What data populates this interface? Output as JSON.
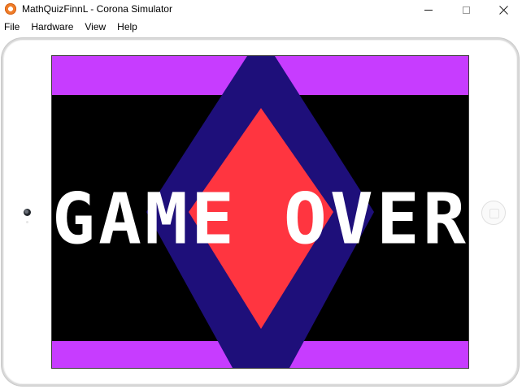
{
  "window": {
    "title": "MathQuizFinnL - Corona Simulator",
    "icon": "corona-app-icon",
    "controls": {
      "minimize_icon": "minimize-icon",
      "maximize_icon": "maximize-icon",
      "close_icon": "close-icon"
    }
  },
  "menubar": {
    "items": [
      {
        "label": "File"
      },
      {
        "label": "Hardware"
      },
      {
        "label": "View"
      },
      {
        "label": "Help"
      }
    ]
  },
  "device": {
    "type": "tablet",
    "orientation": "landscape",
    "home_button_icon": "home-button-icon",
    "camera_icon": "camera-icon"
  },
  "game": {
    "headline": "GAME OVER",
    "colors": {
      "background": "#000000",
      "band": "#c73cff",
      "outer_diamond": "#1e0f7a",
      "inner_diamond": "#ff3540",
      "text": "#ffffff"
    }
  }
}
